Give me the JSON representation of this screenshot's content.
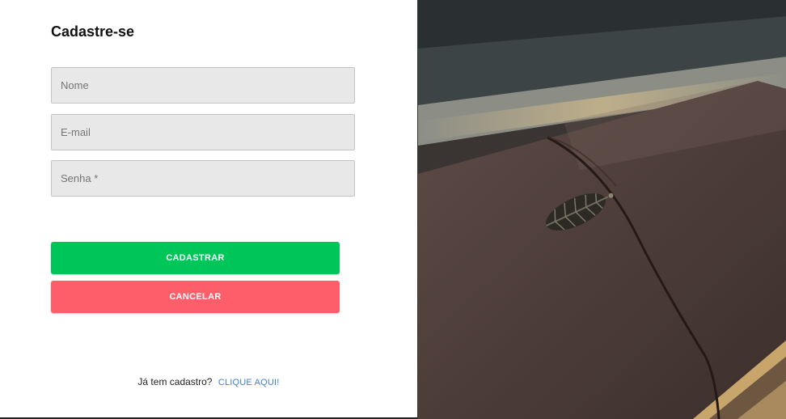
{
  "form": {
    "title": "Cadastre-se",
    "name_placeholder": "Nome",
    "email_placeholder": "E-mail",
    "password_placeholder": "Senha *",
    "submit_label": "CADASTRAR",
    "cancel_label": "CANCELAR"
  },
  "login_prompt": {
    "text": "Já tem cadastro?",
    "link_label": "CLIQUE AQUI!"
  },
  "colors": {
    "submit": "#00c659",
    "cancel": "#fe5d6a",
    "link": "#3f7fd1"
  },
  "decor": {
    "photo": "leather notebook with leaf charm"
  }
}
